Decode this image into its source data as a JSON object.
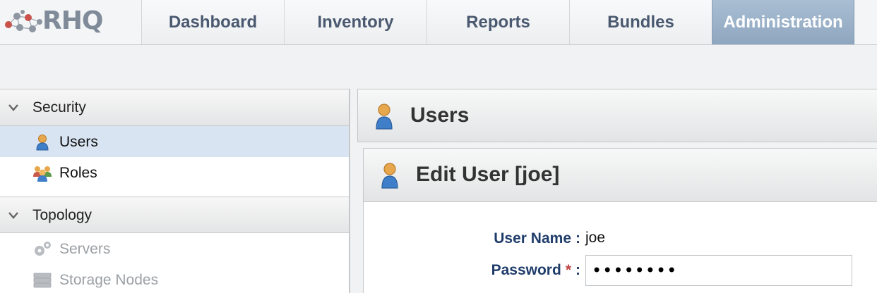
{
  "app": {
    "logo_text": "RHQ"
  },
  "nav_tabs": [
    {
      "label": "Dashboard"
    },
    {
      "label": "Inventory"
    },
    {
      "label": "Reports"
    },
    {
      "label": "Bundles"
    },
    {
      "label": "Administration",
      "active": true
    }
  ],
  "sidebar": {
    "sections": [
      {
        "label": "Security",
        "expanded": true,
        "items": [
          {
            "label": "Users",
            "icon": "user-icon",
            "selected": true
          },
          {
            "label": "Roles",
            "icon": "roles-icon"
          }
        ]
      },
      {
        "label": "Topology",
        "expanded": true,
        "items": [
          {
            "label": "Servers",
            "icon": "servers-icon",
            "disabled": true
          },
          {
            "label": "Storage Nodes",
            "icon": "storage-icon",
            "disabled": true
          }
        ]
      }
    ]
  },
  "main": {
    "title": "Users",
    "edit_panel": {
      "title": "Edit User [joe]",
      "fields": {
        "user_name_label": "User Name",
        "user_name_value": "joe",
        "password_label": "Password",
        "password_required_mark": "*",
        "password_value": "••••••••"
      }
    }
  },
  "colors": {
    "active_tab": "#8ea6bf",
    "selected_nav": "#d9e4f2",
    "form_label": "#1f3c6b",
    "required": "#b44444"
  }
}
